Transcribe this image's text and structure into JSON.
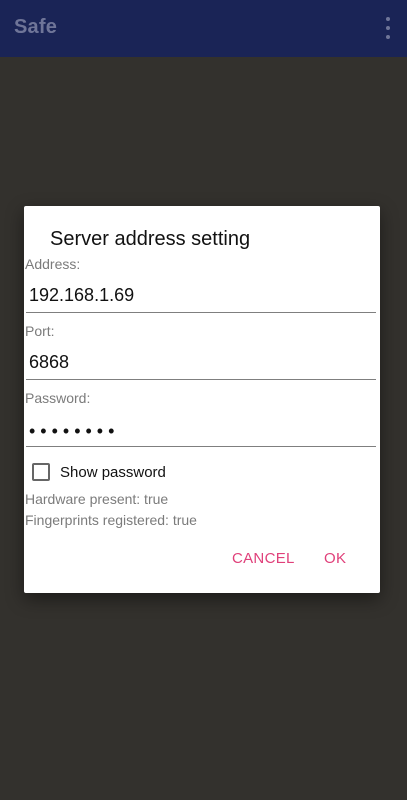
{
  "app_bar": {
    "title": "Safe",
    "overflow_icon": "more-vert-icon"
  },
  "dialog": {
    "title": "Server address setting",
    "address": {
      "label": "Address:",
      "value": "192.168.1.69"
    },
    "port": {
      "label": "Port:",
      "value": "6868"
    },
    "password": {
      "label": "Password:",
      "masked_value": "••••••••"
    },
    "show_password": {
      "label": "Show password",
      "checked": false
    },
    "info": {
      "hardware": "Hardware present: true",
      "fingerprints": "Fingerprints registered: true"
    },
    "buttons": {
      "cancel": "CANCEL",
      "ok": "OK"
    }
  },
  "colors": {
    "app_bar": "#1a2456",
    "accent": "#e0407a",
    "scrim": "#33312d"
  }
}
